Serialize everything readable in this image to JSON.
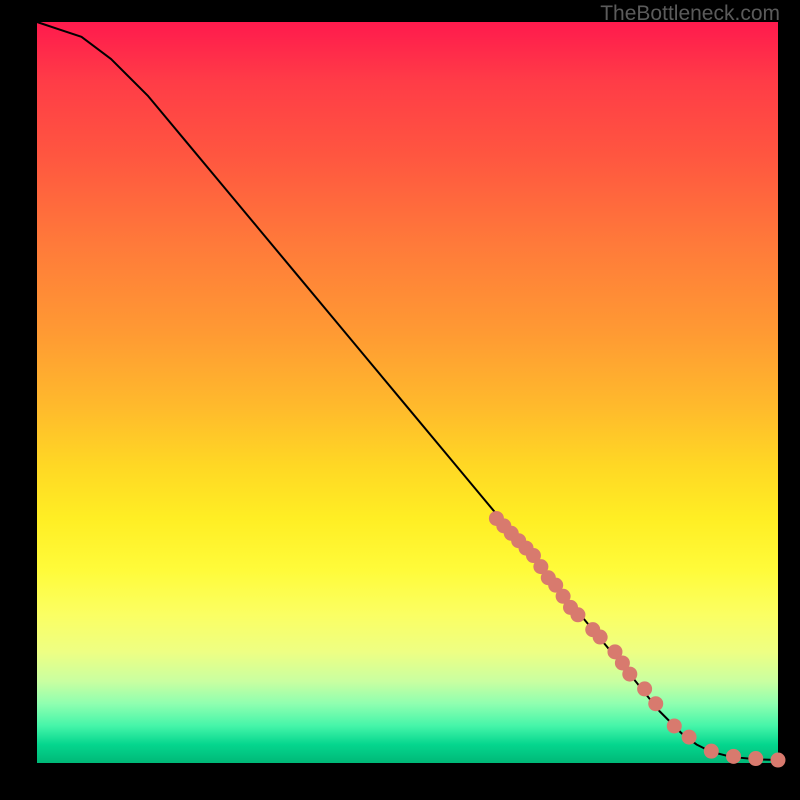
{
  "watermark": "TheBottleneck.com",
  "chart_data": {
    "type": "line",
    "title": "",
    "xlabel": "",
    "ylabel": "",
    "xlim": [
      0,
      100
    ],
    "ylim": [
      0,
      100
    ],
    "grid": false,
    "legend": false,
    "series": [
      {
        "name": "curve",
        "x": [
          0,
          3,
          6,
          10,
          15,
          20,
          25,
          30,
          35,
          40,
          45,
          50,
          55,
          60,
          65,
          70,
          75,
          80,
          84,
          87,
          89,
          91,
          93,
          95,
          97,
          100
        ],
        "y": [
          100,
          99,
          98,
          95,
          90,
          84,
          78,
          72,
          66,
          60,
          54,
          48,
          42,
          36,
          30,
          24,
          18,
          12,
          7,
          4,
          2.5,
          1.5,
          1,
          0.7,
          0.5,
          0.4
        ]
      }
    ],
    "markers": {
      "name": "highlight-points",
      "color": "#d87a6e",
      "x": [
        62,
        63,
        64,
        65,
        66,
        67,
        68,
        69,
        70,
        71,
        72,
        73,
        75,
        76,
        78,
        79,
        80,
        82,
        83.5,
        86,
        88,
        91,
        94,
        97,
        100
      ],
      "y": [
        33,
        32,
        31,
        30,
        29,
        28,
        26.5,
        25,
        24,
        22.5,
        21,
        20,
        18,
        17,
        15,
        13.5,
        12,
        10,
        8,
        5,
        3.5,
        1.6,
        0.9,
        0.6,
        0.4
      ]
    }
  },
  "colors": {
    "marker": "#d87a6e",
    "line": "#000000",
    "background": "#000000"
  }
}
